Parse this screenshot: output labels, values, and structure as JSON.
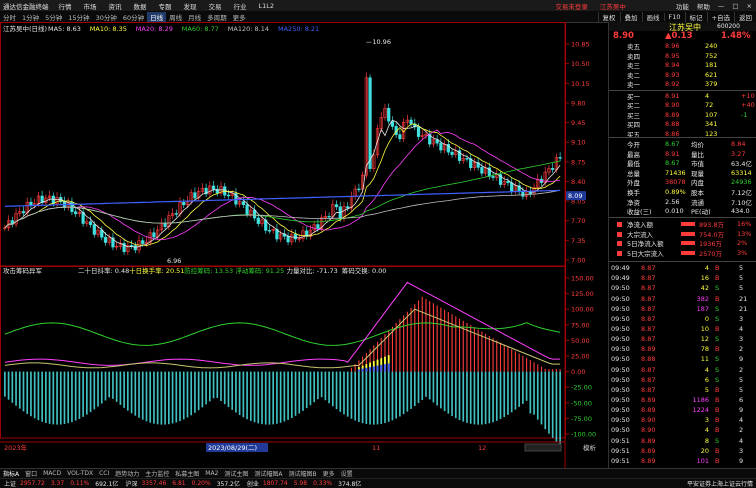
{
  "titlebar": {
    "app_title": "通达信金融终端",
    "menus": [
      "行情",
      "市场",
      "资讯",
      "数据",
      "专题",
      "发现",
      "交易",
      "行业",
      "L1L2"
    ],
    "account_links": [
      "交易未登录",
      "江苏吴中"
    ],
    "window_buttons": [
      "功能",
      "帮助",
      "—",
      "□",
      "×"
    ]
  },
  "toolbar": {
    "periods": [
      "分时",
      "1分钟",
      "5分钟",
      "15分钟",
      "30分钟",
      "60分钟",
      "日线",
      "周线",
      "月线",
      "多周期",
      "更多"
    ],
    "active_period": "日线",
    "right_buttons": [
      "复权",
      "叠加",
      "画线",
      "F10",
      "标记",
      "+自选",
      "返回"
    ]
  },
  "main_chart": {
    "title": "江苏吴中(日线)",
    "ma_legend": [
      {
        "text": "MA5: 8.63",
        "color": "#e6e6e6"
      },
      {
        "text": "MA10: 8.35",
        "color": "#ffff40"
      },
      {
        "text": "MA20: 8.29",
        "color": "#ff40ff"
      },
      {
        "text": "MA60: 8.77",
        "color": "#2fd12f"
      },
      {
        "text": "MA120: 8.14",
        "color": "#c0c0c0"
      },
      {
        "text": "MA250: 8.21",
        "color": "#4060ff"
      }
    ],
    "high_label": "10.96",
    "low_label": "6.96",
    "current_price_label": "8.09",
    "y_ticks": [
      "10.85",
      "10.50",
      "10.15",
      "9.80",
      "9.45",
      "9.10",
      "8.75",
      "8.40",
      "8.05",
      "7.70",
      "7.35",
      "7.00"
    ]
  },
  "indicator": {
    "title": "攻击筹码异军",
    "legend": [
      {
        "text": "二十日抖率: 0.48",
        "color": "#e6e6e6"
      },
      {
        "text": "十日换手率: 20.51",
        "color": "#ffff40"
      },
      {
        "text": "防控筹码: 13.53",
        "color": "#2fd12f"
      },
      {
        "text": "浮动筹码: 91.25",
        "color": "#2fd12f"
      },
      {
        "text": "力量对比: -71.73",
        "color": "#e6e6e6"
      },
      {
        "text": "筹码交换: 0.00",
        "color": "#e6e6e6"
      }
    ],
    "y_ticks": [
      "150.00",
      "125.00",
      "100.00",
      "75.00",
      "50.00",
      "25.00",
      "0.00",
      "-25.00",
      "-50.00",
      "-75.00",
      "-100.00"
    ]
  },
  "date_axis": {
    "labels": [
      "2023年",
      "2023/08/29(二)",
      "11",
      "12"
    ],
    "right_label": "模析"
  },
  "indicator_tabs": {
    "items": [
      "指标A",
      "窗口",
      "MACD",
      "VOL-TDX",
      "CCI",
      "趋势动力",
      "主力监控",
      "私募主图",
      "MA2",
      "测试主图",
      "测试幅图A",
      "测试幅图B",
      "更多",
      "设置"
    ],
    "row2": [
      "扩展▲",
      "关联报价",
      "资金分布",
      "综合资讯",
      "行业资讯",
      "互动问答",
      "普及版",
      "功能说明"
    ]
  },
  "quote": {
    "name": "江苏吴中",
    "code": "600200",
    "price": "8.90",
    "change": "▲0.13",
    "pct": "1.48%",
    "sells": [
      {
        "label": "卖五",
        "price": "8.96",
        "vol": "240"
      },
      {
        "label": "卖四",
        "price": "8.95",
        "vol": "752"
      },
      {
        "label": "卖三",
        "price": "8.94",
        "vol": "181"
      },
      {
        "label": "卖二",
        "price": "8.93",
        "vol": "621"
      },
      {
        "label": "卖一",
        "price": "8.92",
        "vol": "379"
      }
    ],
    "buys": [
      {
        "label": "买一",
        "price": "8.91",
        "vol": "4",
        "delta": "+10"
      },
      {
        "label": "买二",
        "price": "8.90",
        "vol": "72",
        "delta": "+40"
      },
      {
        "label": "买三",
        "price": "8.89",
        "vol": "107",
        "delta": "-1"
      },
      {
        "label": "买四",
        "price": "8.88",
        "vol": "341",
        "delta": ""
      },
      {
        "label": "买五",
        "price": "8.86",
        "vol": "123",
        "delta": ""
      }
    ],
    "stats": [
      {
        "l1": "今开",
        "v1": "8.67",
        "c1": "green",
        "l2": "均价",
        "v2": "8.84",
        "c2": "red"
      },
      {
        "l1": "最高",
        "v1": "8.91",
        "c1": "red",
        "l2": "量比",
        "v2": "3.27",
        "c2": "red"
      },
      {
        "l1": "最低",
        "v1": "8.67",
        "c1": "green",
        "l2": "市值",
        "v2": "63.4亿",
        "c2": "white"
      },
      {
        "l1": "总量",
        "v1": "71436",
        "c1": "yellow",
        "l2": "现量",
        "v2": "63314",
        "c2": "yellow"
      },
      {
        "l1": "外盘",
        "v1": "38078",
        "c1": "red",
        "l2": "内盘",
        "v2": "24936",
        "c2": "green"
      },
      {
        "l1": "换手",
        "v1": "0.89%",
        "c1": "yellow",
        "l2": "股本",
        "v2": "7.12亿",
        "c2": "white"
      },
      {
        "l1": "净资",
        "v1": "2.56",
        "c1": "white",
        "l2": "流通",
        "v2": "7.10亿",
        "c2": "white"
      },
      {
        "l1": "收益(三)",
        "v1": "0.010",
        "c1": "white",
        "l2": "PE(动)",
        "v2": "434.0",
        "c2": "white"
      }
    ],
    "flows": [
      {
        "label": "净流入额",
        "value": "893.8万",
        "pct": "16%"
      },
      {
        "label": "大宗流入",
        "value": "754.0万",
        "pct": "13%"
      },
      {
        "label": "5日净流入额",
        "value": "1936万",
        "pct": "2%"
      },
      {
        "label": "5日大宗流入",
        "value": "2570万",
        "pct": "3%"
      }
    ],
    "ticks": [
      {
        "t": "09:49",
        "p": "8.87",
        "v": "4",
        "f": "B",
        "n": "5"
      },
      {
        "t": "09:49",
        "p": "8.87",
        "v": "16",
        "f": "B",
        "n": "5"
      },
      {
        "t": "09:50",
        "p": "8.87",
        "v": "42",
        "f": "S",
        "n": "5"
      },
      {
        "t": "09:50",
        "p": "8.87",
        "v": "382",
        "f": "B",
        "n": "21"
      },
      {
        "t": "09:50",
        "p": "8.87",
        "v": "187",
        "f": "S",
        "n": "21"
      },
      {
        "t": "09:50",
        "p": "8.87",
        "v": "0",
        "f": "S",
        "n": "3"
      },
      {
        "t": "09:50",
        "p": "8.87",
        "v": "10",
        "f": "B",
        "n": "4"
      },
      {
        "t": "09:50",
        "p": "8.87",
        "v": "12",
        "f": "S",
        "n": "3"
      },
      {
        "t": "09:50",
        "p": "8.89",
        "v": "78",
        "f": "B",
        "n": "2"
      },
      {
        "t": "09:50",
        "p": "8.88",
        "v": "11",
        "f": "S",
        "n": "9"
      },
      {
        "t": "09:50",
        "p": "8.87",
        "v": "4",
        "f": "S",
        "n": "2"
      },
      {
        "t": "09:50",
        "p": "8.87",
        "v": "6",
        "f": "S",
        "n": "5"
      },
      {
        "t": "09:50",
        "p": "8.87",
        "v": "5",
        "f": "B",
        "n": "5"
      },
      {
        "t": "09:50",
        "p": "8.89",
        "v": "1186",
        "f": "B",
        "n": "6"
      },
      {
        "t": "09:50",
        "p": "8.89",
        "v": "1224",
        "f": "B",
        "n": "9"
      },
      {
        "t": "09:50",
        "p": "8.90",
        "v": "3",
        "f": "B",
        "n": "4"
      },
      {
        "t": "09:50",
        "p": "8.90",
        "v": "4",
        "f": "B",
        "n": "2"
      },
      {
        "t": "09:51",
        "p": "8.89",
        "v": "8",
        "f": "S",
        "n": "4"
      },
      {
        "t": "09:51",
        "p": "8.89",
        "v": "20",
        "f": "B",
        "n": "3"
      },
      {
        "t": "09:51",
        "p": "8.89",
        "v": "101",
        "f": "B",
        "n": "9"
      }
    ]
  },
  "statusbar": {
    "indices": [
      {
        "name": "上证",
        "value": "2957.72",
        "chg": "3.37",
        "pct": "0.11%",
        "amt": "692.1亿"
      },
      {
        "name": "沪深",
        "value": "3357.46",
        "chg": "6.81",
        "pct": "0.20%",
        "amt": "357.2亿"
      },
      {
        "name": "创业",
        "value": "1807.74",
        "chg": "5.98",
        "pct": "0.33%",
        "amt": "374.8亿"
      }
    ],
    "broker": "平安证券上海上证云行情",
    "time": "09:51:04"
  },
  "colors": {
    "up": "#ff3c3c",
    "down": "#2fd12f",
    "accent": "#ffff40",
    "axis": "#c00000"
  }
}
